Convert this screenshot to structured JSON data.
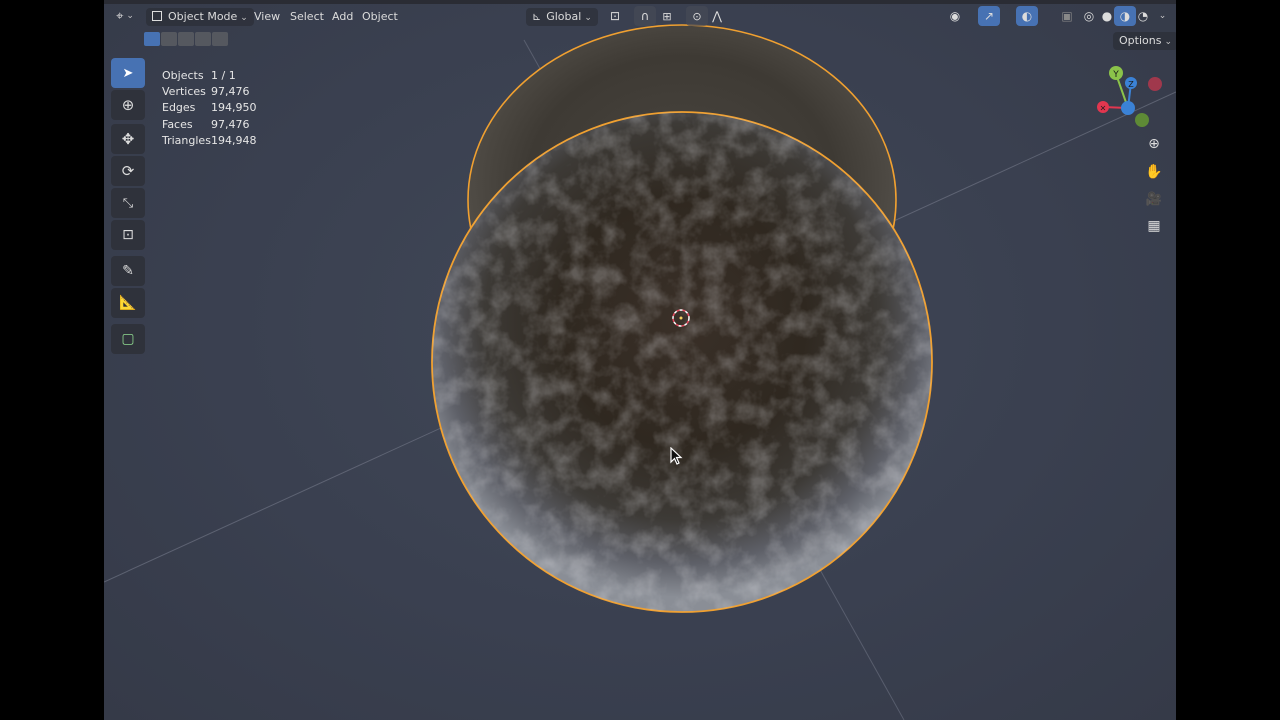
{
  "header": {
    "mode_label": "Object Mode",
    "menus": [
      "View",
      "Select",
      "Add",
      "Object"
    ],
    "transform_orientation": "Global",
    "options_label": "Options"
  },
  "stats": [
    {
      "label": "Objects",
      "value": "1 / 1"
    },
    {
      "label": "Vertices",
      "value": "97,476"
    },
    {
      "label": "Edges",
      "value": "194,950"
    },
    {
      "label": "Faces",
      "value": "97,476"
    },
    {
      "label": "Triangles",
      "value": "194,948"
    }
  ],
  "gizmo": {
    "y_label": "Y",
    "z_label": "Z"
  },
  "toolbar_tools": [
    "select-box",
    "cursor",
    "move",
    "rotate",
    "scale",
    "transform",
    "annotate",
    "measure",
    "add-cube"
  ],
  "colors": {
    "selection_outline": "#f0a030",
    "active_tool": "#4772b3",
    "axis_x": "#e2364f",
    "axis_y": "#8bc34a",
    "axis_z": "#3b82d6"
  }
}
